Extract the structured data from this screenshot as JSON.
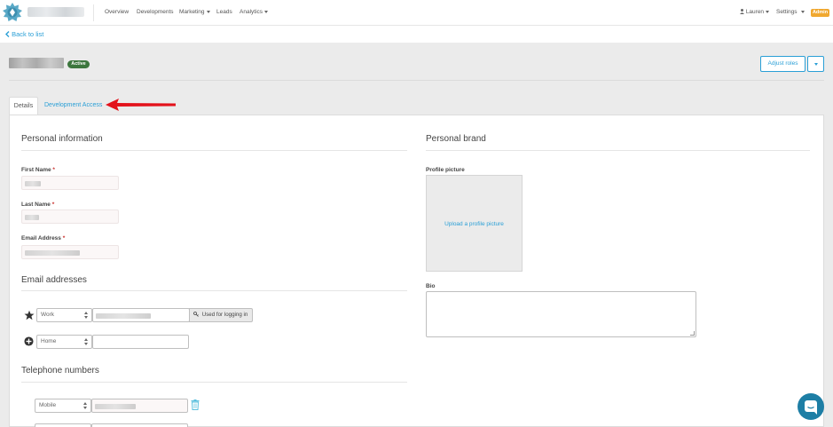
{
  "nav": {
    "items": [
      {
        "label": "Overview",
        "dropdown": false
      },
      {
        "label": "Developments",
        "dropdown": false
      },
      {
        "label": "Marketing",
        "dropdown": true
      },
      {
        "label": "Leads",
        "dropdown": false
      },
      {
        "label": "Analytics",
        "dropdown": true
      }
    ],
    "user_label": "Lauren",
    "settings_label": "Settings",
    "admin_label": "Admin"
  },
  "back_link": "Back to list",
  "header": {
    "status": "Active",
    "adjust_roles": "Adjust roles"
  },
  "tabs": [
    {
      "label": "Details",
      "active": true
    },
    {
      "label": "Development Access",
      "active": false
    }
  ],
  "personal": {
    "title": "Personal information",
    "first_name_label": "First Name",
    "last_name_label": "Last Name",
    "email_label": "Email Address",
    "required_mark": "*"
  },
  "emails": {
    "title": "Email addresses",
    "rows": [
      {
        "type": "Work",
        "used_for_login": "Used for logging in"
      },
      {
        "type": "Home"
      }
    ]
  },
  "phones": {
    "title": "Telephone numbers",
    "rows": [
      {
        "type": "Mobile"
      }
    ]
  },
  "brand": {
    "title": "Personal brand",
    "profile_picture_label": "Profile picture",
    "upload_link": "Upload a profile picture",
    "bio_label": "Bio"
  },
  "colors": {
    "accent": "#2a9fd6",
    "status_green": "#3c763d",
    "admin_orange": "#f0a830",
    "annotation_red": "#e3121b",
    "chat_blue": "#1d7ea5"
  }
}
